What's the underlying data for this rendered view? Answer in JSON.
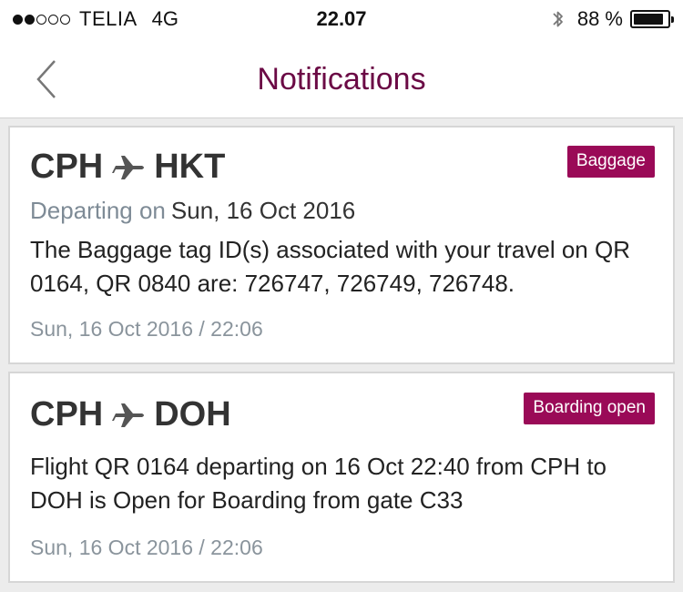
{
  "status_bar": {
    "carrier": "TELIA",
    "network": "4G",
    "time": "22.07",
    "battery": "88 %",
    "battery_level": 0.88,
    "signal_bars_filled": 2,
    "signal_bars_total": 5
  },
  "nav": {
    "title": "Notifications",
    "back_icon": "chevron-left-icon"
  },
  "notifications": [
    {
      "origin": "CPH",
      "destination": "HKT",
      "badge": "Baggage",
      "departing_label": "Departing on",
      "departing_date": "Sun, 16 Oct 2016",
      "message": "The Baggage tag ID(s) associated with your travel on QR 0164, QR 0840 are: 726747, 726749, 726748.",
      "timestamp": "Sun, 16 Oct 2016 / 22:06"
    },
    {
      "origin": "CPH",
      "destination": "DOH",
      "badge": "Boarding open",
      "message": "Flight QR 0164 departing on 16 Oct 22:40 from CPH to DOH is Open for Boarding from gate C33",
      "timestamp": "Sun, 16 Oct 2016 / 22:06"
    }
  ],
  "colors": {
    "brand": "#6b0a45",
    "badge": "#9a0a57",
    "muted": "#7e8b96",
    "background": "#ececec"
  }
}
